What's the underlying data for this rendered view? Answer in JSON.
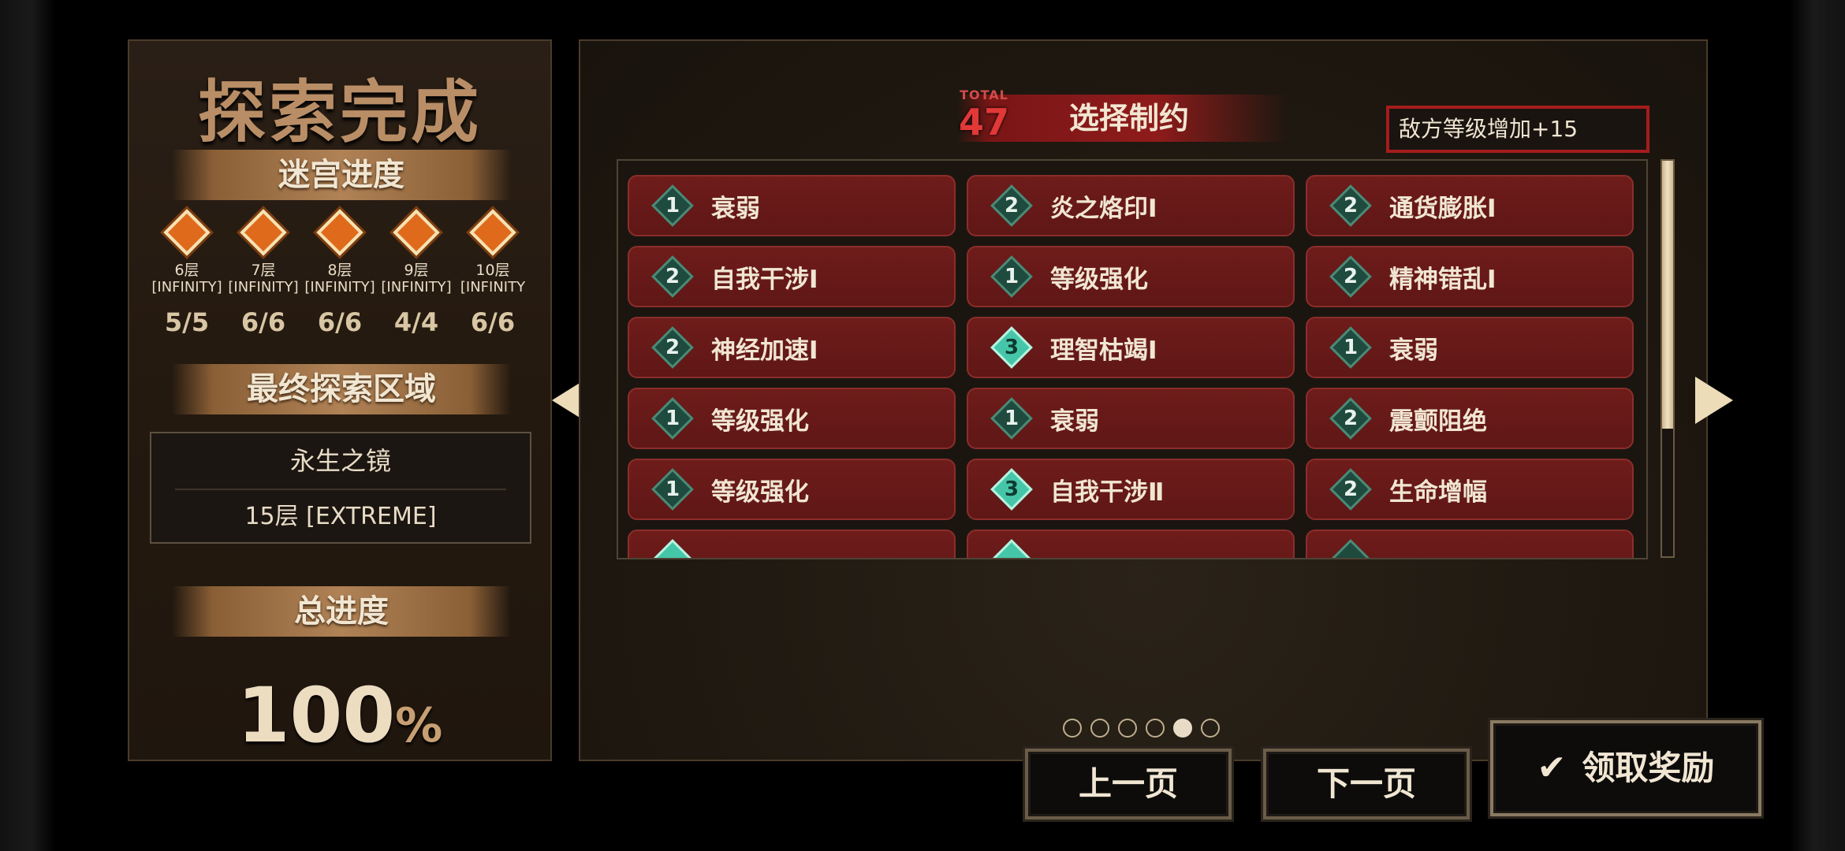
{
  "left_panel": {
    "title": "探索完成",
    "labyrinth_progress_label": "迷宫进度",
    "floors": [
      {
        "name": "6层",
        "mode": "[INFINITY]",
        "count": "5/5"
      },
      {
        "name": "7层",
        "mode": "[INFINITY]",
        "count": "6/6"
      },
      {
        "name": "8层",
        "mode": "[INFINITY]",
        "count": "6/6"
      },
      {
        "name": "9层",
        "mode": "[INFINITY]",
        "count": "4/4"
      },
      {
        "name": "10层",
        "mode": "[INFINITY",
        "count": "6/6"
      }
    ],
    "final_region_label": "最终探索区域",
    "final_region_name": "永生之镜",
    "final_region_floor": "15层 [EXTREME]",
    "total_progress_label": "总进度",
    "total_progress_value": "100",
    "total_progress_unit": "%"
  },
  "right_panel": {
    "total_label": "TOTAL",
    "total_value": "47",
    "title": "选择制约",
    "effect_text": "敌方等级增加+15",
    "constraints": [
      {
        "level": "1",
        "label": "衰弱"
      },
      {
        "level": "2",
        "label": "炎之烙印Ⅰ"
      },
      {
        "level": "2",
        "label": "通货膨胀Ⅰ"
      },
      {
        "level": "2",
        "label": "自我干涉Ⅰ"
      },
      {
        "level": "1",
        "label": "等级强化"
      },
      {
        "level": "2",
        "label": "精神错乱Ⅰ"
      },
      {
        "level": "2",
        "label": "神经加速Ⅰ"
      },
      {
        "level": "3",
        "label": "理智枯竭Ⅰ"
      },
      {
        "level": "1",
        "label": "衰弱"
      },
      {
        "level": "1",
        "label": "等级强化"
      },
      {
        "level": "1",
        "label": "衰弱"
      },
      {
        "level": "2",
        "label": "震颤阻绝"
      },
      {
        "level": "1",
        "label": "等级强化"
      },
      {
        "level": "3",
        "label": "自我干涉Ⅱ"
      },
      {
        "level": "2",
        "label": "生命增幅"
      }
    ],
    "pagination": {
      "total_pages": 6,
      "current_page": 5
    }
  },
  "buttons": {
    "prev": "上一页",
    "next": "下一页",
    "claim": "领取奖励"
  },
  "colors": {
    "accent_red": "#a61c1c",
    "cell_red": "#6e1c1a",
    "gold": "#b98e66"
  }
}
